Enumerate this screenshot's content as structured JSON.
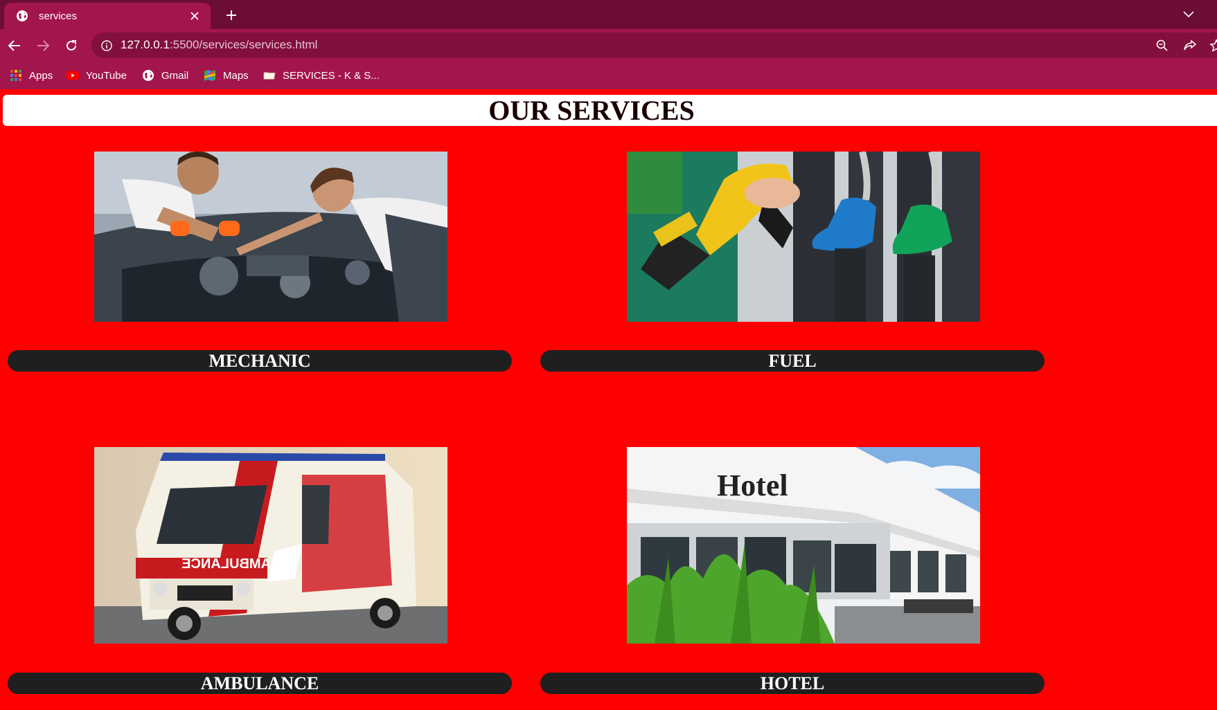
{
  "browser": {
    "tab_title": "services",
    "url_host": "127.0.0.1",
    "url_path": ":5500/services/services.html",
    "bookmarks": [
      {
        "label": "Apps",
        "icon": "apps-grid-icon"
      },
      {
        "label": "YouTube",
        "icon": "youtube-icon"
      },
      {
        "label": "Gmail",
        "icon": "globe-icon"
      },
      {
        "label": "Maps",
        "icon": "maps-icon"
      },
      {
        "label": "SERVICES - K & S...",
        "icon": "folder-icon"
      }
    ],
    "colors": {
      "tabstrip": "#6b0d36",
      "toolbar": "#a3154d",
      "omnibox": "#820f3e"
    }
  },
  "page": {
    "title": "OUR SERVICES",
    "background": "#ff0000",
    "services": [
      {
        "label": "MECHANIC",
        "image": "mechanics-working-on-car-engine"
      },
      {
        "label": "FUEL",
        "image": "fuel-pump-nozzles"
      },
      {
        "label": "AMBULANCE",
        "image": "ambulance-van"
      },
      {
        "label": "HOTEL",
        "image": "hotel-building-exterior"
      }
    ]
  }
}
